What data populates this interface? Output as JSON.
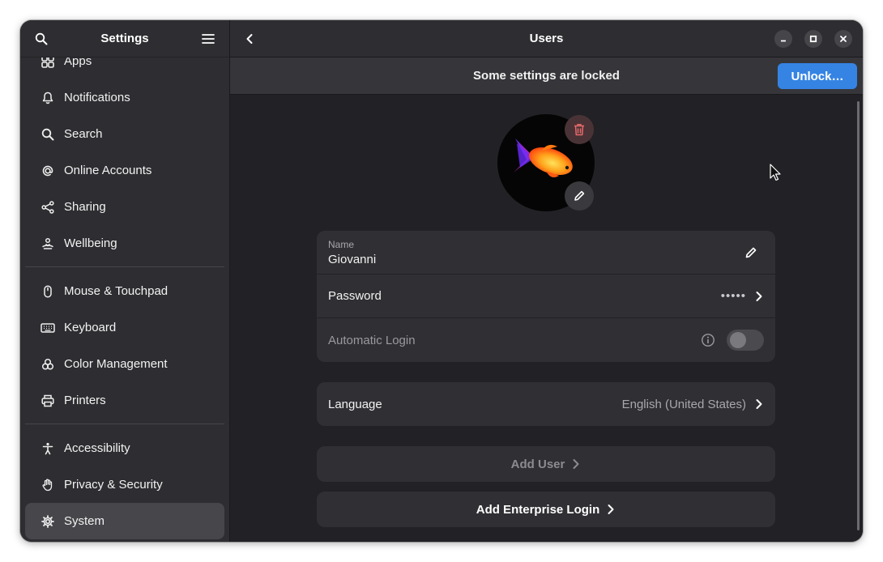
{
  "sidebar": {
    "title": "Settings",
    "search_icon": "search-icon",
    "menu_icon": "hamburger-menu-icon",
    "items": [
      {
        "label": "Apps",
        "icon": "apps-icon"
      },
      {
        "label": "Notifications",
        "icon": "bell-icon"
      },
      {
        "label": "Search",
        "icon": "search-icon"
      },
      {
        "label": "Online Accounts",
        "icon": "at-icon"
      },
      {
        "label": "Sharing",
        "icon": "share-icon"
      },
      {
        "label": "Wellbeing",
        "icon": "wellbeing-icon"
      },
      {
        "label": "Mouse & Touchpad",
        "icon": "mouse-icon"
      },
      {
        "label": "Keyboard",
        "icon": "keyboard-icon"
      },
      {
        "label": "Color Management",
        "icon": "color-icon"
      },
      {
        "label": "Printers",
        "icon": "printer-icon"
      },
      {
        "label": "Accessibility",
        "icon": "accessibility-icon"
      },
      {
        "label": "Privacy & Security",
        "icon": "hand-icon"
      },
      {
        "label": "System",
        "icon": "gear-icon"
      }
    ],
    "active_item": "System"
  },
  "header": {
    "title": "Users"
  },
  "banner": {
    "text": "Some settings are locked",
    "unlock_label": "Unlock…"
  },
  "user": {
    "name_label": "Name",
    "name_value": "Giovanni",
    "password_label": "Password",
    "password_value": "•••••",
    "auto_login_label": "Automatic Login",
    "auto_login_enabled": false,
    "language_label": "Language",
    "language_value": "English (United States)"
  },
  "actions": {
    "add_user": "Add User",
    "add_enterprise_login": "Add Enterprise Login"
  },
  "colors": {
    "accent": "#3584e4",
    "delete": "#e66a6a"
  }
}
